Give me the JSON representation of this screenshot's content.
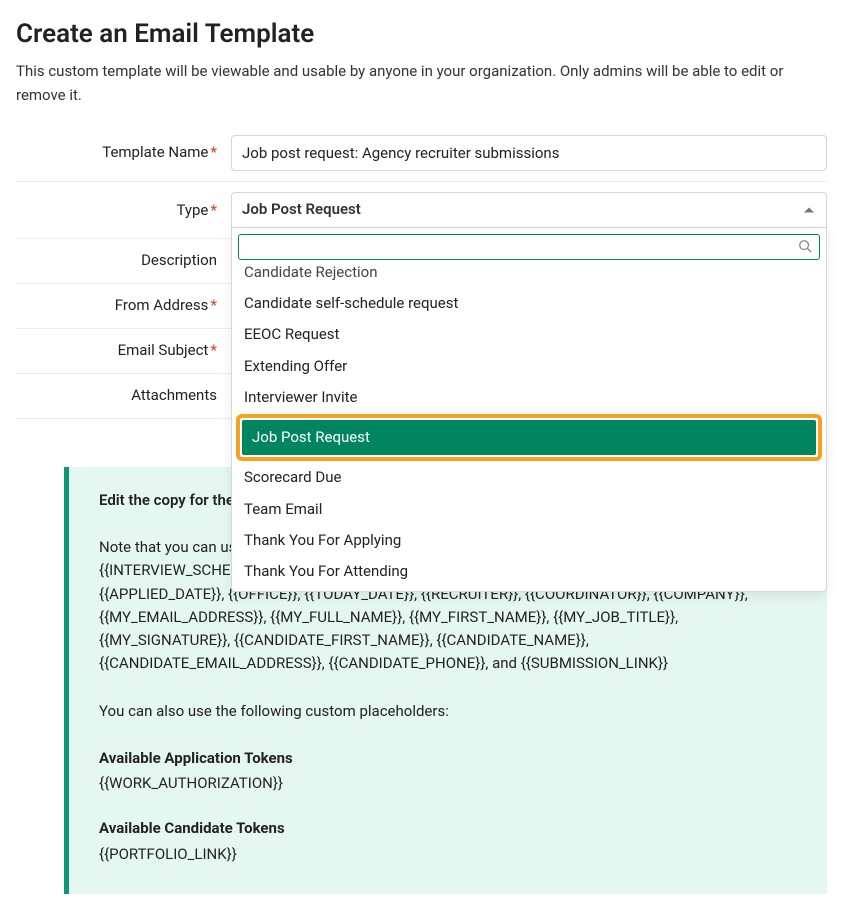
{
  "header": {
    "title": "Create an Email Template",
    "subtitle": "This custom template will be viewable and usable by anyone in your organization. Only admins will be able to edit or remove it."
  },
  "labels": {
    "template_name": "Template Name",
    "type": "Type",
    "description": "Description",
    "from_address": "From Address",
    "email_subject": "Email Subject",
    "attachments": "Attachments",
    "required_mark": "*"
  },
  "fields": {
    "template_name_value": "Job post request: Agency recruiter submissions",
    "type_selected": "Job Post Request",
    "type_search_value": ""
  },
  "type_options": {
    "0": "Candidate Rejection",
    "1": "Candidate self-schedule request",
    "2": "EEOC Request",
    "3": "Extending Offer",
    "4": "Interviewer Invite",
    "5": "Job Post Request",
    "6": "Scorecard Due",
    "7": "Team Email",
    "8": "Thank You For Applying",
    "9": "Thank You For Attending"
  },
  "help": {
    "lead_visible": "Edit the copy for the ",
    "placeholders_intro": "Note that you can use the following placeholders: {{INTERVIEW_SCHEDULE}}, {{INTERVIEW_SCHEDULE_START_TIME}}, {{JOB_NAME}}, {{SOURCE}}, {{START_DATE}}, {{APPLIED_DATE}}, {{OFFICE}}, {{TODAY_DATE}}, {{RECRUITER}}, {{COORDINATOR}}, {{COMPANY}}, {{MY_EMAIL_ADDRESS}}, {{MY_FULL_NAME}}, {{MY_FIRST_NAME}}, {{MY_JOB_TITLE}}, {{MY_SIGNATURE}}, {{CANDIDATE_FIRST_NAME}}, {{CANDIDATE_NAME}}, {{CANDIDATE_EMAIL_ADDRESS}}, {{CANDIDATE_PHONE}}, and {{SUBMISSION_LINK}}",
    "custom_intro": "You can also use the following custom placeholders:",
    "app_tokens_title": "Available Application Tokens",
    "app_tokens": "{{WORK_AUTHORIZATION}}",
    "cand_tokens_title": "Available Candidate Tokens",
    "cand_tokens": "{{PORTFOLIO_LINK}}"
  }
}
